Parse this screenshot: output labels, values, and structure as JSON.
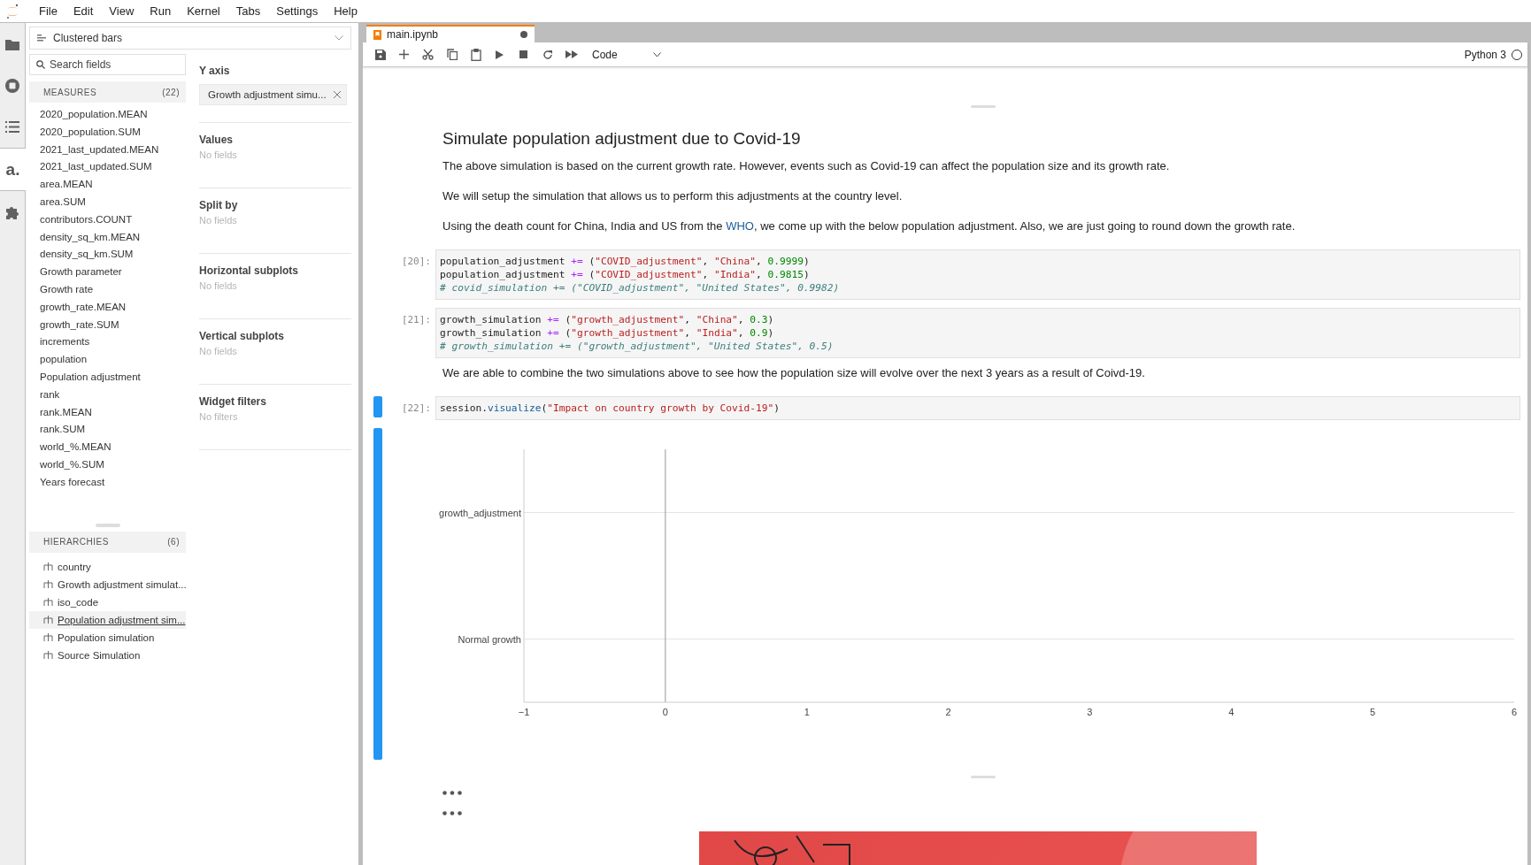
{
  "menu": [
    "File",
    "Edit",
    "View",
    "Run",
    "Kernel",
    "Tabs",
    "Settings",
    "Help"
  ],
  "rail": [
    {
      "kind": "folder",
      "selected": false
    },
    {
      "kind": "stop",
      "selected": false
    },
    {
      "kind": "list",
      "selected": false
    },
    {
      "kind": "glyph",
      "text": "a.",
      "selected": true
    },
    {
      "kind": "puzzle",
      "selected": false
    }
  ],
  "widget": {
    "chart_type": "Clustered bars",
    "search": {
      "placeholder": "Search fields"
    },
    "measures": {
      "title": "MEASURES",
      "count": "(22)",
      "items": [
        "2020_population.MEAN",
        "2020_population.SUM",
        "2021_last_updated.MEAN",
        "2021_last_updated.SUM",
        "area.MEAN",
        "area.SUM",
        "contributors.COUNT",
        "density_sq_km.MEAN",
        "density_sq_km.SUM",
        "Growth parameter",
        "Growth rate",
        "growth_rate.MEAN",
        "growth_rate.SUM",
        "increments",
        "population",
        "Population adjustment",
        "rank",
        "rank.MEAN",
        "rank.SUM",
        "world_%.MEAN",
        "world_%.SUM",
        "Years forecast"
      ]
    },
    "hierarchies": {
      "title": "HIERARCHIES",
      "count": "(6)",
      "items": [
        {
          "label": "country",
          "hovered": false
        },
        {
          "label": "Growth adjustment simulat...",
          "hovered": false
        },
        {
          "label": "iso_code",
          "hovered": false
        },
        {
          "label": "Population adjustment sim...",
          "hovered": true
        },
        {
          "label": "Population simulation",
          "hovered": false
        },
        {
          "label": "Source Simulation",
          "hovered": false
        }
      ]
    },
    "sections": [
      {
        "title": "Y axis",
        "chips": [
          "Growth adjustment simu..."
        ]
      },
      {
        "title": "Values",
        "empty": "No fields"
      },
      {
        "title": "Split by",
        "empty": "No fields"
      },
      {
        "title": "Horizontal subplots",
        "empty": "No fields"
      },
      {
        "title": "Vertical subplots",
        "empty": "No fields"
      },
      {
        "title": "Widget filters",
        "empty": "No filters"
      }
    ]
  },
  "notebook": {
    "tab": {
      "title": "main.ipynb",
      "unsaved": true
    },
    "toolbar": {
      "cell_type": "Code",
      "kernel": "Python 3"
    },
    "heading": "Simulate population adjustment due to Covid-19",
    "cells": [
      {
        "kind": "text",
        "text": "The above simulation is based on the current growth rate. However, events such as Covid-19 can affect the population size and its growth rate."
      },
      {
        "kind": "text",
        "text": "We will setup the simulation that allows us to perform this adjustments at the country level."
      },
      {
        "kind": "text",
        "text": "Using the death count for China, India and US from the ",
        "link": "WHO",
        "after": ", we come up with the below population adjustment. Also, we are just going to round down the growth rate."
      },
      {
        "kind": "code",
        "prompt": "[20]:",
        "selected": false,
        "lines": [
          "population_adjustment += (\"COVID_adjustment\", \"China\", 0.9999)",
          "population_adjustment += (\"COVID_adjustment\", \"India\", 0.9815)",
          "# covid_simulation += (\"COVID_adjustment\", \"United States\", 0.9982)"
        ]
      },
      {
        "kind": "code",
        "prompt": "[21]:",
        "selected": false,
        "lines": [
          "growth_simulation += (\"growth_adjustment\", \"China\", 0.3)",
          "growth_simulation += (\"growth_adjustment\", \"India\", 0.9)",
          "# growth_simulation += (\"growth_adjustment\", \"United States\", 0.5)"
        ]
      },
      {
        "kind": "text",
        "text": "We are able to combine the two simulations above to see how the population size will evolve over the next 3 years as a result of Coivd-19."
      },
      {
        "kind": "code",
        "prompt": "[22]:",
        "selected": true,
        "lines": [
          "session.visualize(\"Impact on country growth by Covid-19\")"
        ],
        "chart_data": {
          "type": "bar",
          "orientation": "horizontal",
          "categories": [
            "growth_adjustment",
            "Normal growth"
          ],
          "values": [
            null,
            null
          ],
          "xlim": [
            -1,
            6
          ],
          "xticks": [
            {
              "value": -1,
              "label": "−1"
            },
            0,
            1,
            2,
            3,
            4,
            5,
            6
          ]
        }
      }
    ]
  }
}
